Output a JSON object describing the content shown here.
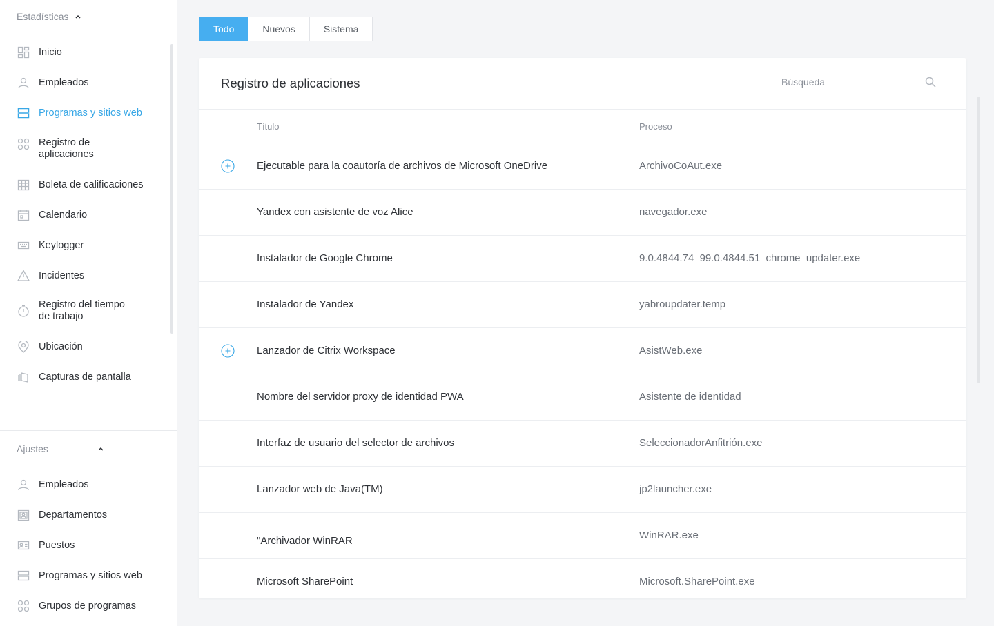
{
  "sidebar": {
    "stats_heading": "Estadísticas",
    "settings_heading": "Ajustes",
    "stats_items": [
      {
        "label": "Inicio",
        "icon": "dashboard-grid-icon"
      },
      {
        "label": "Empleados",
        "icon": "user-icon"
      },
      {
        "label": "Programas y sitios web",
        "icon": "server-stack-icon",
        "active": true
      },
      {
        "label": "Registro de\naplicaciones",
        "icon": "apps-grid-icon"
      },
      {
        "label": "Boleta de calificaciones",
        "icon": "table-grid-icon"
      },
      {
        "label": "Calendario",
        "icon": "calendar-icon"
      },
      {
        "label": "Keylogger",
        "icon": "keyboard-icon"
      },
      {
        "label": "Incidentes",
        "icon": "warning-triangle-icon"
      },
      {
        "label": "Registro del tiempo\nde trabajo",
        "icon": "stopwatch-icon"
      },
      {
        "label": "Ubicación",
        "icon": "location-pin-icon"
      },
      {
        "label": "Capturas de pantalla",
        "icon": "screenshots-stack-icon"
      }
    ],
    "settings_items": [
      {
        "label": "Empleados",
        "icon": "user-icon"
      },
      {
        "label": "Departamentos",
        "icon": "department-badge-icon"
      },
      {
        "label": "Puestos",
        "icon": "id-card-icon"
      },
      {
        "label": "Programas y sitios web",
        "icon": "server-stack-icon"
      },
      {
        "label": "Grupos de programas",
        "icon": "apps-grid-icon"
      }
    ]
  },
  "tabs": [
    {
      "label": "Todo",
      "active": true
    },
    {
      "label": "Nuevos",
      "active": false
    },
    {
      "label": "Sistema",
      "active": false
    }
  ],
  "card": {
    "title": "Registro de aplicaciones",
    "search_placeholder": "Búsqueda",
    "columns": {
      "title": "Título",
      "process": "Proceso"
    },
    "rows": [
      {
        "title": "Ejecutable para la coautoría de archivos de Microsoft OneDrive",
        "process": "ArchivoCoAut.exe",
        "expandable": true
      },
      {
        "title": "Yandex con asistente de voz Alice",
        "process": "navegador.exe",
        "expandable": false
      },
      {
        "title": "Instalador de Google Chrome",
        "process": "9.0.4844.74_99.0.4844.51_chrome_updater.exe",
        "expandable": false
      },
      {
        "title": "Instalador de Yandex",
        "process": "yabroupdater.temp",
        "expandable": false
      },
      {
        "title": "Lanzador de Citrix Workspace",
        "process": "AsistWeb.exe",
        "expandable": true
      },
      {
        "title": "Nombre del servidor proxy de identidad PWA",
        "process": "Asistente de identidad",
        "expandable": false
      },
      {
        "title": "Interfaz de usuario del selector de archivos",
        "process": "SeleccionadorAnfitrión.exe",
        "expandable": false
      },
      {
        "title": "Lanzador web de Java(TM)",
        "process": "jp2launcher.exe",
        "expandable": false
      },
      {
        "title": "\"Archivador WinRAR",
        "process": "WinRAR.exe",
        "expandable": false
      },
      {
        "title": "Microsoft SharePoint",
        "process": "Microsoft.SharePoint.exe",
        "expandable": false
      }
    ]
  },
  "colors": {
    "accent": "#38a7e6",
    "tab_active": "#46aef0",
    "text": "#2f3237",
    "muted": "#8a8f98"
  }
}
